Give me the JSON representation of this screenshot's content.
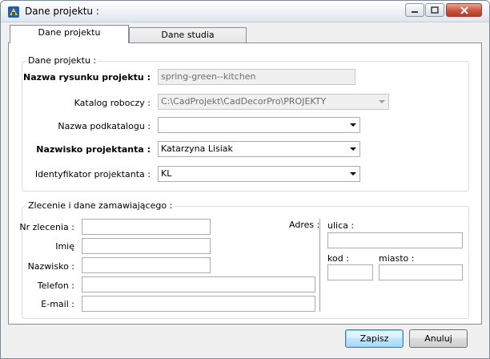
{
  "window": {
    "title": "Dane projektu :"
  },
  "tabs": [
    {
      "label": "Dane projektu"
    },
    {
      "label": "Dane studia"
    }
  ],
  "project_group": {
    "legend": "Dane projektu :",
    "name_label": "Nazwa rysunku projektu :",
    "name_value": "spring-green--kitchen",
    "catalog_label": "Katalog roboczy :",
    "catalog_value": "C:\\CadProjekt\\CadDecorPro\\PROJEKTY",
    "subcatalog_label": "Nazwa podkatalogu :",
    "subcatalog_value": "",
    "designer_label": "Nazwisko projektanta :",
    "designer_value": "Katarzyna Lisiak",
    "designer_id_label": "Identyfikator projektanta :",
    "designer_id_value": "KL"
  },
  "client_group": {
    "legend": "Zlecenie i dane zamawiającego :",
    "order_label": "Nr zlecenia :",
    "first_name_label": "Imię",
    "last_name_label": "Nazwisko :",
    "phone_label": "Telefon :",
    "email_label": "E-mail :",
    "address_label": "Adres :",
    "street_label": "ulica :",
    "code_label": "kod :",
    "city_label": "miasto :"
  },
  "buttons": {
    "save": "Zapisz",
    "cancel": "Anuluj"
  }
}
